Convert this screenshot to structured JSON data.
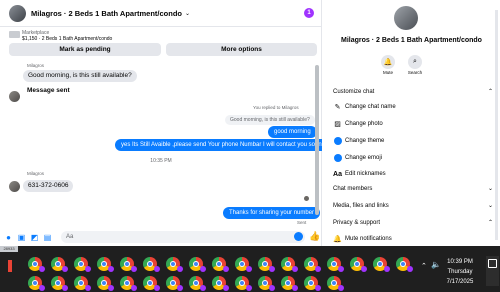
{
  "chat": {
    "title": "Milagros · 2 Beds 1 Bath Apartment/condo",
    "notification_count": "1",
    "listing": {
      "label": "Marketplace",
      "price_title": "$1,150 · 2 Beds 1 Bath Apartment/condo"
    },
    "mark_pending_label": "Mark as pending",
    "more_options_label": "More options",
    "messages": {
      "sender_top": "Milagros",
      "in_1": "Good morning, is this still available?",
      "in_2": "Message sent",
      "reply_note": "You replied to Milagros",
      "reply_quote": "Good morning, is this still available?",
      "out_1": "good morning",
      "out_2": "yes Its Still Avaible ,please send Your phone Numbar I will contact you soon.",
      "timestamp": "10:35 PM",
      "sender_bottom": "Milagros",
      "in_3": "631-372-0606",
      "out_3": "Thanks for sharing your number",
      "sent_label": "Sent"
    },
    "composer_placeholder": "Aa"
  },
  "info": {
    "title": "Milagros · 2 Beds 1 Bath Apartment/condo",
    "mute_label": "Mute",
    "search_label": "Search",
    "customize_chat": "Customize chat",
    "change_chat_name": "Change chat name",
    "change_photo": "Change photo",
    "change_theme": "Change theme",
    "change_emoji": "Change emoji",
    "edit_nicknames": "Edit nicknames",
    "chat_members": "Chat members",
    "media_files_links": "Media, files and links",
    "privacy_support": "Privacy & support",
    "mute_notifications": "Mute notifications"
  },
  "taskbar": {
    "time": "10:39 PM",
    "day": "Thursday",
    "date": "7/17/2025",
    "status_strip": "28933"
  },
  "colors": {
    "accent": "#0a7cff",
    "badge": "#a033ff",
    "taskbar": "#1f1f1f"
  }
}
